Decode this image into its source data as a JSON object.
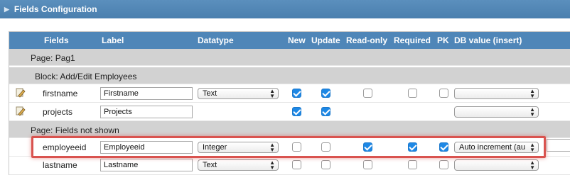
{
  "panel": {
    "title": "Fields Configuration",
    "expand_icon": "triangle-right-icon"
  },
  "columns": {
    "fields": "Fields",
    "label": "Label",
    "datatype": "Datatype",
    "new": "New",
    "update": "Update",
    "readonly": "Read-only",
    "required": "Required",
    "pk": "PK",
    "dbvalue": "DB value (insert)"
  },
  "groups": {
    "page1": "Page: Pag1",
    "block": "Block: Add/Edit Employees",
    "notshown": "Page: Fields not shown"
  },
  "rows": [
    {
      "field": "firstname",
      "label": "Firstname",
      "datatype": "Text",
      "new": true,
      "update": true,
      "readonly": false,
      "required": false,
      "pk": false,
      "dbvalue": ""
    },
    {
      "field": "projects",
      "label": "Projects",
      "datatype": "",
      "new": true,
      "update": true,
      "dbvalue": ""
    },
    {
      "field": "employeeid",
      "label": "Employeeid",
      "datatype": "Integer",
      "new": false,
      "update": false,
      "readonly": true,
      "required": true,
      "pk": true,
      "dbvalue": "Auto increment (au"
    },
    {
      "field": "lastname",
      "label": "Lastname",
      "datatype": "Text",
      "new": false,
      "update": false,
      "readonly": false,
      "required": false,
      "pk": false,
      "dbvalue": ""
    }
  ],
  "colors": {
    "header_blue": "#4f86b8",
    "highlight_red": "#d9534f",
    "check_blue": "#1e88e5"
  }
}
